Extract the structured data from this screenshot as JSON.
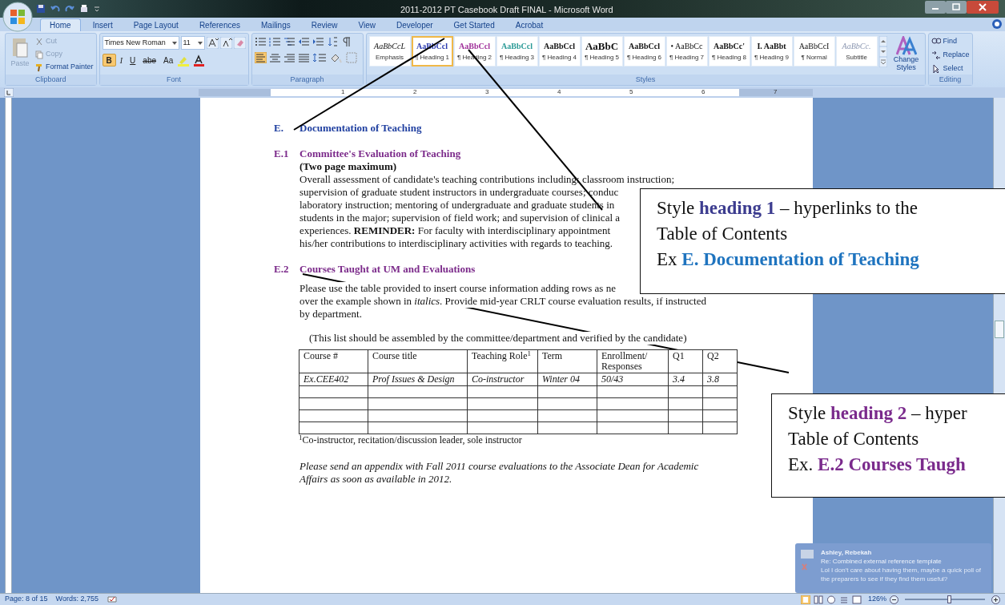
{
  "window": {
    "title": "2011-2012 PT Casebook Draft FINAL  -  Microsoft Word"
  },
  "tabs": [
    {
      "label": "Home",
      "selected": true
    },
    {
      "label": "Insert",
      "selected": false
    },
    {
      "label": "Page Layout",
      "selected": false
    },
    {
      "label": "References",
      "selected": false
    },
    {
      "label": "Mailings",
      "selected": false
    },
    {
      "label": "Review",
      "selected": false
    },
    {
      "label": "View",
      "selected": false
    },
    {
      "label": "Developer",
      "selected": false
    },
    {
      "label": "Get Started",
      "selected": false
    },
    {
      "label": "Acrobat",
      "selected": false
    }
  ],
  "ribbon": {
    "clipboard": {
      "paste": "Paste",
      "cut": "Cut",
      "copy": "Copy",
      "format_painter": "Format Painter",
      "label": "Clipboard"
    },
    "font": {
      "font_name": "Times New Roman",
      "font_size": "11",
      "label": "Font",
      "buttons": [
        {
          "label": "B",
          "kind": "bold",
          "on": true
        },
        {
          "label": "I",
          "kind": "italic",
          "on": false
        },
        {
          "label": "U",
          "kind": "underline",
          "on": false
        },
        {
          "label": "abe",
          "kind": "strike",
          "on": false
        },
        {
          "label": "Aa",
          "kind": "case",
          "on": false
        }
      ]
    },
    "paragraph": {
      "label": "Paragraph"
    },
    "styles": {
      "label": "Styles",
      "items": [
        {
          "preview": "AaBbCcL",
          "name": "Emphasis",
          "kind": "italic",
          "selected": false
        },
        {
          "preview": "AaBbCcl",
          "name": "¶ Heading 1",
          "kind": "bold",
          "color": "#2b3bb0",
          "selected": true
        },
        {
          "preview": "AaBbCcl",
          "name": "¶ Heading 2",
          "kind": "bold",
          "color": "#a0309a",
          "selected": false
        },
        {
          "preview": "AaBbCcl",
          "name": "¶ Heading 3",
          "kind": "bold",
          "color": "#2a9a96",
          "selected": false
        },
        {
          "preview": "AaBbCcl",
          "name": "¶ Heading 4",
          "kind": "bold",
          "selected": false
        },
        {
          "preview": "AaBbC",
          "name": "¶ Heading 5",
          "kind": "large",
          "selected": false
        },
        {
          "preview": "AaBbCcl",
          "name": "¶ Heading 6",
          "kind": "bold",
          "selected": false
        },
        {
          "preview": "• AaBbCc",
          "name": "¶ Heading 7",
          "kind": "plain",
          "selected": false
        },
        {
          "preview": "AaBbCc'",
          "name": "¶ Heading 8",
          "kind": "bold",
          "selected": false
        },
        {
          "preview": "I.  AaBbt",
          "name": "¶ Heading 9",
          "kind": "bold",
          "selected": false
        },
        {
          "preview": "AaBbCcI",
          "name": "¶ Normal",
          "kind": "plain",
          "selected": false
        },
        {
          "preview": "AaBbCc.",
          "name": "Subtitle",
          "kind": "italic",
          "color": "#8a96b0",
          "selected": false
        }
      ],
      "change_styles": "Change Styles"
    },
    "editing": {
      "find": "Find",
      "replace": "Replace",
      "select": "Select",
      "label": "Editing"
    }
  },
  "ruler": {
    "numbers": [
      "1",
      "2",
      "3",
      "4",
      "5",
      "6",
      "7"
    ]
  },
  "document": {
    "h1": {
      "number": "E.",
      "text": "Documentation of Teaching"
    },
    "e1": {
      "number": "E.1",
      "text": "Committee's Evaluation of Teaching",
      "subheading": "(Two page maximum)",
      "lines": [
        "Overall assessment of candidate's teaching contributions including:  classroom instruction;",
        "supervision of graduate student instructors in undergraduate courses; conduc",
        "laboratory instruction; mentoring of undergraduate and graduate students in",
        "students in the major; supervision of field work; and supervision of clinical a",
        "experiences.  **REMINDER:**  For faculty with interdisciplinary appointment",
        "his/her contributions to interdisciplinary activities with regards to teaching."
      ]
    },
    "e2": {
      "number": "E.2",
      "text": "Courses Taught at UM and Evaluations",
      "lines": [
        "Please use the table provided to insert course information adding rows as ne",
        "over the example shown in *italics*.  Provide mid-year CRLT course evaluation results, if instructed",
        "by department."
      ],
      "note": "(This list should be assembled by the committee/department and verified by the candidate)",
      "table": {
        "columns": [
          "Course #",
          "Course title",
          "Teaching Role$^{1}$",
          "Term",
          "Enrollment/ Responses",
          "Q1",
          "Q2"
        ],
        "rows": [
          [
            "Ex.CEE402",
            "Prof Issues & Design",
            "Co-instructor",
            "Winter 04",
            "50/43",
            "3.4",
            "3.8"
          ]
        ]
      },
      "footnote": "$^{1}$Co-instructor, recitation/discussion leader, sole instructor",
      "closing": [
        "Please send an appendix with Fall 2011 course evaluations to the Associate Dean for Academic",
        "Affairs as soon as available in 2012."
      ]
    }
  },
  "callouts": [
    {
      "lines": [
        [
          {
            "text": "Style "
          },
          {
            "text": "heading 1",
            "bold": true,
            "color": "#3c3c8f"
          },
          {
            "text": " – hyperlinks to the"
          }
        ],
        [
          {
            "text": "Table of Contents"
          }
        ],
        [
          {
            "text": "Ex "
          },
          {
            "text": "E. Documentation of Teaching",
            "bold": true,
            "color": "#1f74bf"
          }
        ]
      ]
    },
    {
      "lines": [
        [
          {
            "text": "Style "
          },
          {
            "text": "heading 2",
            "bold": true,
            "color": "#7a2a8c"
          },
          {
            "text": " – hyper"
          }
        ],
        [
          {
            "text": "Table of Contents"
          }
        ],
        [
          {
            "text": "Ex. "
          },
          {
            "text": "E.2 Courses Taugh",
            "bold": true,
            "color": "#7a2a8c"
          }
        ]
      ]
    }
  ],
  "notification": {
    "sender": "Ashley, Rebekah",
    "subject": "Re: Combined external reference template",
    "preview": [
      "Lol I don't care about having them, maybe a quick poll of",
      "the preparers to see if they find them useful?"
    ]
  },
  "status_bar": {
    "page": "Page: 8 of 15",
    "words": "Words: 2,755",
    "zoom": "126%",
    "zoom_level": {
      "level": 0.55
    }
  }
}
